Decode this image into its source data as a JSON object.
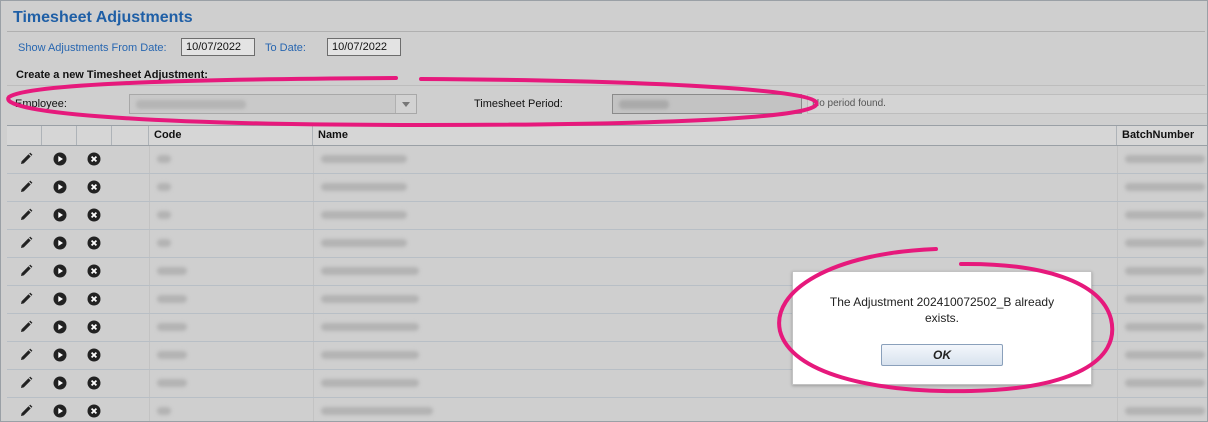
{
  "page": {
    "title": "Timesheet Adjustments"
  },
  "filters": {
    "from_label": "Show Adjustments From Date:",
    "from_value": "10/07/2022",
    "to_label": "To Date:",
    "to_value": "10/07/2022"
  },
  "create": {
    "heading": "Create a new Timesheet Adjustment:",
    "employee_label": "Employee:",
    "period_label": "Timesheet Period:",
    "no_period_text": "No period found."
  },
  "grid": {
    "columns": [
      "",
      "",
      "",
      "",
      "Code",
      "Name",
      "BatchNumber"
    ],
    "row_count": 10
  },
  "dialog": {
    "message": "The Adjustment 202410072502_B already exists.",
    "ok_label": "OK"
  },
  "colors": {
    "title": "#1f5fa6",
    "label_blue": "#2766b0",
    "annotation": "#e6197c"
  },
  "icons": [
    "pencil-icon",
    "play-circle-icon",
    "close-circle-icon",
    "chevron-down-icon"
  ]
}
